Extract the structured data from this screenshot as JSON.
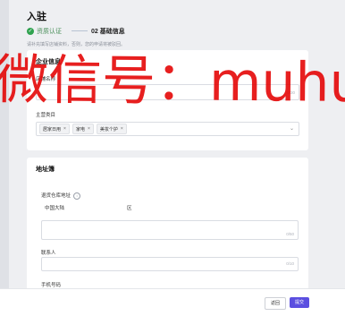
{
  "header": {
    "title": "入驻",
    "step1_label": "资质认证",
    "step2_label": "02 基础信息",
    "hint": "请补充填写店铺资料，否则，您的申请将被驳回。"
  },
  "company_section": {
    "title": "企业信息",
    "name_label": "店铺名称",
    "name_counter": "0/30",
    "category_label": "主营类目",
    "categories": [
      "居家日用",
      "家电",
      "美妆个护"
    ]
  },
  "address_section": {
    "title": "地址簿",
    "return_label": "退货仓库地址",
    "region_value": "中国大陆",
    "region_suffix": "区",
    "address_counter": "0/50",
    "contact_label": "联系人",
    "contact_counter": "0/10",
    "phone_label": "手机号码"
  },
  "footer": {
    "prev_label": "返回",
    "submit_label": "提交"
  },
  "watermark": {
    "text": "微信号：muhuanidc"
  }
}
